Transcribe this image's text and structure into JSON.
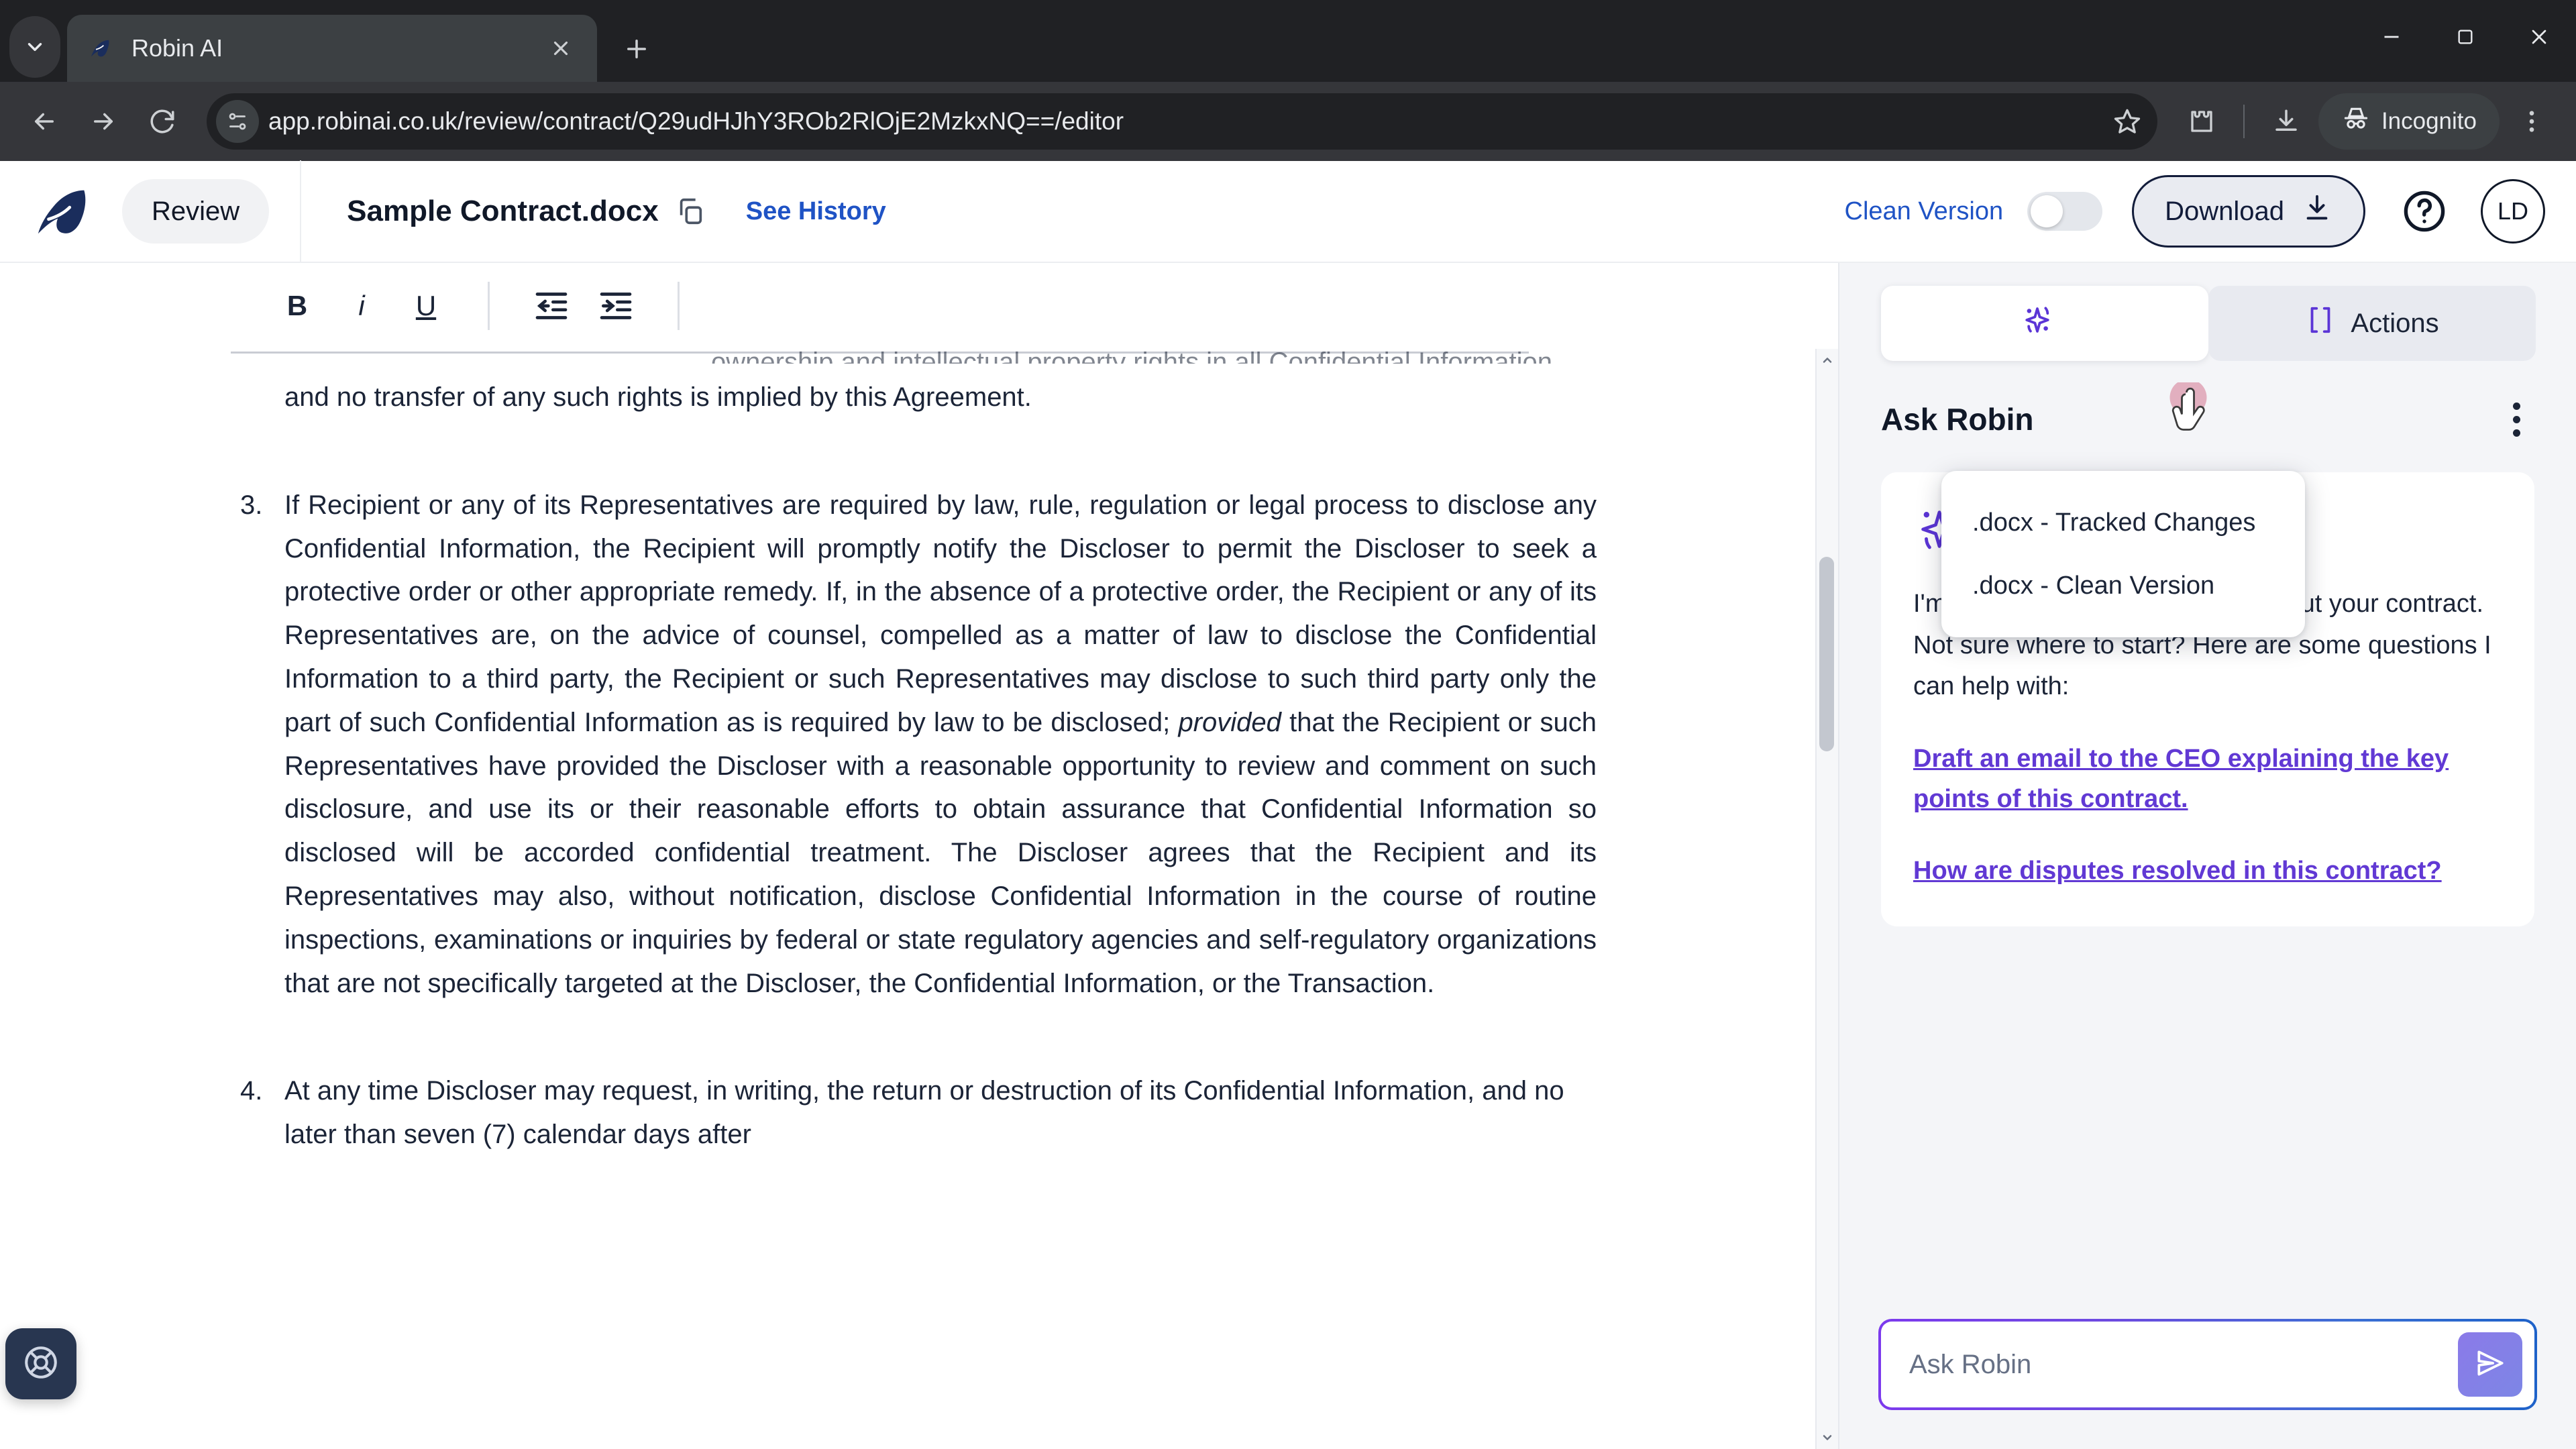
{
  "browser": {
    "tab": {
      "title": "Robin AI",
      "favicon_icon": "robin-bird-favicon",
      "close_icon": "close-icon"
    },
    "tabstrip_chevron_icon": "chevron-down-icon",
    "new_tab_icon": "plus-icon",
    "window_controls": {
      "minimize_icon": "minimize-icon",
      "maximize_icon": "maximize-icon",
      "close_icon": "window-close-icon"
    },
    "nav": {
      "back_icon": "arrow-back-icon",
      "forward_icon": "arrow-forward-icon",
      "reload_icon": "reload-icon"
    },
    "omnibox": {
      "site_info_icon": "site-settings-icon",
      "url": "app.robinai.co.uk/review/contract/Q29udHJhY3ROb2RlOjE2MzkxNQ==/editor",
      "bookmark_icon": "star-icon"
    },
    "actions": {
      "extensions_icon": "extensions-puzzle-icon",
      "downloads_icon": "downloads-icon",
      "incognito_label": "Incognito",
      "incognito_icon": "incognito-hat-icon",
      "menu_icon": "three-dot-menu-icon"
    }
  },
  "app_header": {
    "logo_icon": "robin-bird-logo",
    "review_label": "Review",
    "document_title": "Sample Contract.docx",
    "copy_icon": "copy-icon",
    "see_history_label": "See History",
    "clean_version_label": "Clean Version",
    "clean_version_toggle_state": "off",
    "download_label": "Download",
    "download_icon": "download-icon",
    "help_icon": "help-circle-icon",
    "avatar_initials": "LD"
  },
  "download_menu": {
    "items": [
      {
        "label": ".docx - Tracked Changes"
      },
      {
        "label": ".docx - Clean Version"
      }
    ]
  },
  "doc_toolbar": {
    "bold_label": "B",
    "italic_label": "i",
    "underline_label": "U",
    "outdent_icon": "outdent-icon",
    "indent_icon": "indent-icon"
  },
  "document": {
    "clipped_top_line": "ownership and intellectual property rights in all Confidential Information",
    "continuation_line": "and no transfer of any such rights is implied by this Agreement.",
    "paragraphs": [
      {
        "number": "3.",
        "text_before_italic": "If Recipient or any of its Representatives are required by law, rule, regulation or legal process to disclose any Confidential Information, the Recipient will promptly notify the Discloser to permit the Discloser to seek a protective order or other appropriate remedy. If, in the absence of a protective order, the Recipient or any of its Representatives are, on the advice of counsel, compelled as a matter of law to disclose the Confidential Information to a third party, the Recipient or such Representatives may disclose to such third party only the part of such Confidential Information as is required by law to be disclosed; ",
        "italic_word": "provided",
        "text_after_italic": " that the Recipient or such Representatives have provided the Discloser with a reasonable opportunity to review and comment on such disclosure, and use its or their reasonable efforts to obtain assurance that Confidential Information so disclosed will be accorded confidential treatment. The Discloser agrees that the Recipient and its Representatives may also, without notification, disclose Confidential Information in the course of routine inspections, examinations or inquiries by federal or state regulatory agencies and self-regulatory organizations that are not specifically targeted at the Discloser, the Confidential Information, or the Transaction."
      },
      {
        "number": "4.",
        "text_before_italic": "At any time Discloser may request, in writing, the return or destruction of its Confidential Information, and no later than seven (7) calendar days after",
        "italic_word": "",
        "text_after_italic": ""
      }
    ]
  },
  "support": {
    "icon": "life-ring-support-icon"
  },
  "right_panel": {
    "tabs": [
      {
        "label": "",
        "icon": "sparkle-ai-icon",
        "active": true
      },
      {
        "label": "Actions",
        "icon": "brackets-icon",
        "active": false
      }
    ],
    "panel_title": "Ask Robin",
    "kebab_icon": "three-dot-menu-icon",
    "assistant": {
      "icon": "sparkle-ai-icon",
      "line1": "I'm ready to answer questions about your contract.",
      "line2": "Not sure where to start? Here are some questions I can help with:",
      "suggestions": [
        "Draft an email to the CEO explaining the key points of this contract.",
        "How are disputes resolved in this contract?"
      ]
    },
    "composer": {
      "placeholder": "Ask Robin",
      "value": "",
      "send_icon": "send-paper-plane-icon"
    }
  },
  "colors": {
    "accent_blue": "#1f53c5",
    "accent_purple": "#6139d4",
    "chrome_dark": "#202124",
    "toolbar_dark": "#35363a",
    "ink": "#1b2437"
  }
}
